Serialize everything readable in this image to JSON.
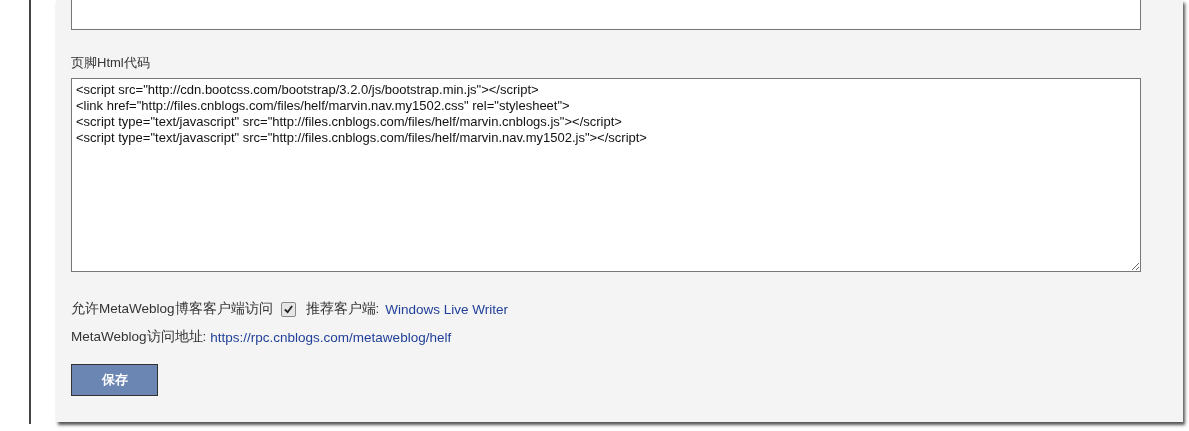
{
  "footer_html": {
    "label": "页脚Html代码",
    "lines": [
      "<script src=\"http://cdn.bootcss.com/bootstrap/3.2.0/js/bootstrap.min.js\"></script>",
      "<link href=\"http://files.cnblogs.com/files/helf/marvin.nav.my1502.css\" rel=\"stylesheet\">",
      "<script type=\"text/javascript\" src=\"http://files.cnblogs.com/files/helf/marvin.cnblogs.js\"></script>",
      "<script type=\"text/javascript\" src=\"http://files.cnblogs.com/files/helf/marvin.nav.my1502.js\"></script>"
    ]
  },
  "metaweblog": {
    "label": "允许MetaWeblog博客客户端访问",
    "checked": true,
    "recommend_label": "推荐客户端:",
    "recommend_link": "Windows Live Writer"
  },
  "address": {
    "label": "MetaWeblog访问地址:",
    "link": "https://rpc.cnblogs.com/metaweblog/helf"
  },
  "save_button": "保存"
}
